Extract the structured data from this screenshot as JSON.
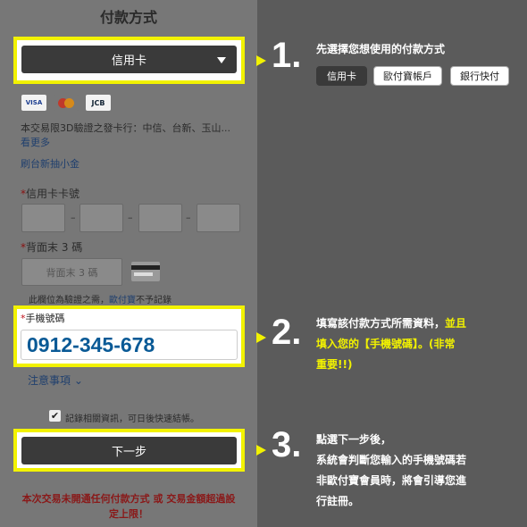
{
  "form": {
    "title": "付款方式",
    "method_select_value": "信用卡",
    "card_brands": [
      "VISA",
      "MasterCard",
      "JCB"
    ],
    "bank_notice": "本交易限3D驗證之發卡行：中信、台新、玉山...",
    "see_more": "看更多",
    "swipe_link": "刷台新抽小金",
    "card_number_label": "信用卡卡號",
    "cvv_label": "背面末 3 碼",
    "cvv_placeholder": "背面末 3 碼",
    "cvv_note_prefix": "此欄位為驗證之需，",
    "cvv_note_link": "歐付寶",
    "cvv_note_suffix": "不予記錄",
    "phone_label": "手機號碼",
    "phone_value": "0912-345-678",
    "notes_link": "注意事項",
    "remember_label": "記錄相關資訊，可日後快速結帳。",
    "remember_checked": true,
    "next_button": "下一步",
    "warning_line1": "本次交易未開通任何付款方式 或 交易金額超過設",
    "warning_line2": "定上限！"
  },
  "steps": [
    {
      "number": "1.",
      "text": "先選擇您想使用的付款方式",
      "options": [
        "信用卡",
        "歐付寶帳戶",
        "銀行快付"
      ]
    },
    {
      "number": "2.",
      "line1_plain": "填寫該付款方式所需資料，",
      "line1_yellow": "並且",
      "line2_yellow": "填入您的【手機號碼】。(非常",
      "line3_yellow": "重要!!)"
    },
    {
      "number": "3.",
      "line1": "點選下一步後，",
      "line2": "系統會判斷您輸入的手機號碼若",
      "line3": "非歐付寶會員時，將會引導您進",
      "line4": "行註冊。"
    }
  ],
  "colors": {
    "highlight": "#f2f200",
    "phone_text": "#0a5a96",
    "warning": "#8a1818"
  }
}
